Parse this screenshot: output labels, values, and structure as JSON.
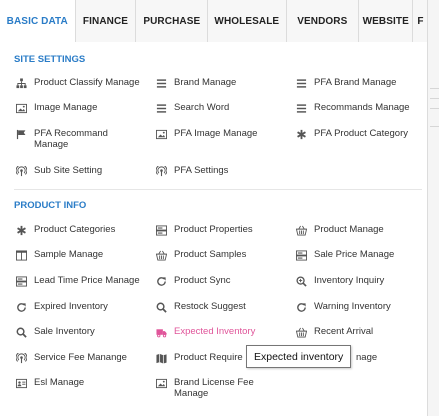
{
  "tabs": [
    {
      "label": "BASIC DATA",
      "active": true
    },
    {
      "label": "FINANCE",
      "active": false
    },
    {
      "label": "PURCHASE",
      "active": false
    },
    {
      "label": "WHOLESALE",
      "active": false
    },
    {
      "label": "VENDORS",
      "active": false
    },
    {
      "label": "WEBSITE",
      "active": false
    },
    {
      "label": "F",
      "active": false
    }
  ],
  "site_settings": {
    "title": "SITE SETTINGS",
    "items": [
      {
        "label": "Product Classify Manage",
        "icon": "sitemap-icon"
      },
      {
        "label": "Brand Manage",
        "icon": "list-icon"
      },
      {
        "label": "PFA Brand Manage",
        "icon": "list-icon"
      },
      {
        "label": "Image Manage",
        "icon": "image-icon"
      },
      {
        "label": "Search Word",
        "icon": "list-icon"
      },
      {
        "label": "Recommands Manage",
        "icon": "list-icon"
      },
      {
        "label": "PFA Recommand Manage",
        "icon": "flag-icon"
      },
      {
        "label": "PFA Image Manage",
        "icon": "image-icon"
      },
      {
        "label": "PFA Product Category",
        "icon": "asterisk-icon"
      },
      {
        "label": "Sub Site Setting",
        "icon": "broadcast-icon"
      },
      {
        "label": "PFA Settings",
        "icon": "broadcast-icon"
      }
    ]
  },
  "product_info": {
    "title": "PRODUCT INFO",
    "items": [
      {
        "label": "Product Categories",
        "icon": "asterisk-icon"
      },
      {
        "label": "Product Properties",
        "icon": "server-icon"
      },
      {
        "label": "Product Manage",
        "icon": "basket-icon"
      },
      {
        "label": "Sample Manage",
        "icon": "columns-icon"
      },
      {
        "label": "Product Samples",
        "icon": "basket-icon"
      },
      {
        "label": "Sale Price Manage",
        "icon": "server-icon"
      },
      {
        "label": "Lead Time Price Manage",
        "icon": "server-icon"
      },
      {
        "label": "Product Sync",
        "icon": "refresh-icon"
      },
      {
        "label": "Inventory Inquiry",
        "icon": "zoom-in-icon"
      },
      {
        "label": "Expired Inventory",
        "icon": "refresh-icon"
      },
      {
        "label": "Restock Suggest",
        "icon": "search-icon"
      },
      {
        "label": "Warning Inventory",
        "icon": "refresh-icon"
      },
      {
        "label": "Sale Inventory",
        "icon": "search-icon"
      },
      {
        "label": "Expected Inventory",
        "icon": "truck-icon"
      },
      {
        "label": "Recent Arrival",
        "icon": "basket-icon"
      },
      {
        "label": "Service Fee Manange",
        "icon": "broadcast-icon"
      },
      {
        "label": "Product Require",
        "icon": "map-icon"
      },
      {
        "label": "nage",
        "icon": ""
      },
      {
        "label": "Esl Manage",
        "icon": "id-card-icon"
      },
      {
        "label": "Brand License Fee Manage",
        "icon": "image-icon"
      }
    ]
  },
  "tooltip": {
    "text": "Expected inventory"
  },
  "colors": {
    "accent": "#2a7cc7",
    "highlight": "#e0559a"
  }
}
